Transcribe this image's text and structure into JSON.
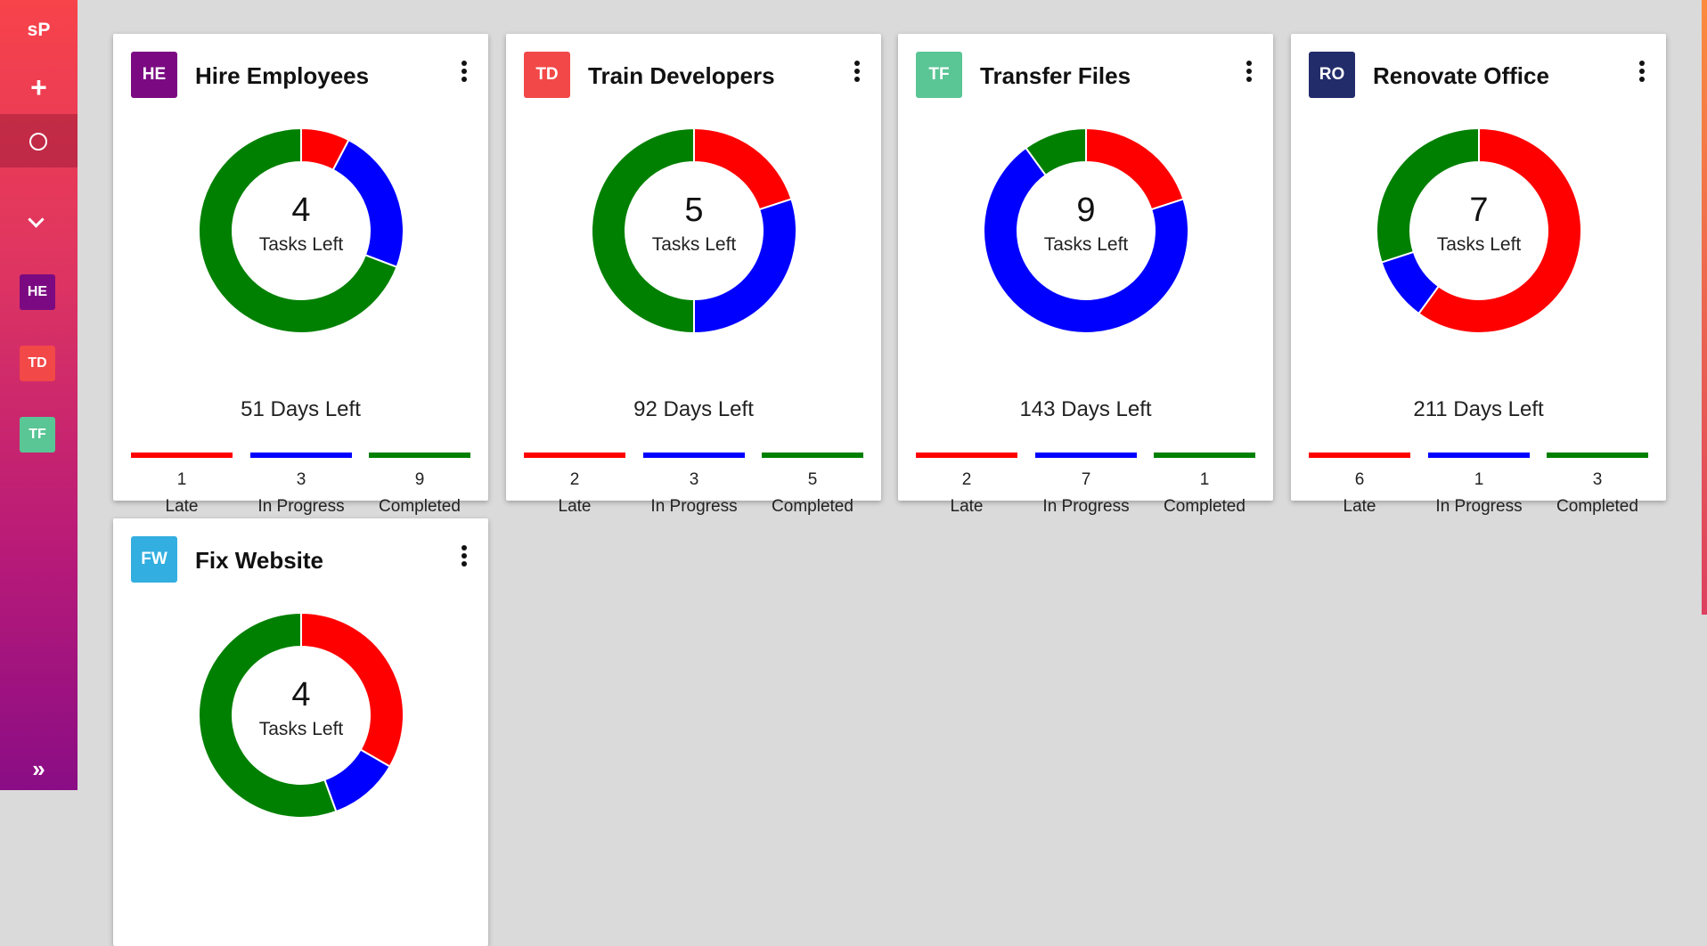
{
  "sidebar": {
    "logo": "sP",
    "add_glyph": "+",
    "active_icon": "circle-icon",
    "chevron_icon": "chevron-down-icon",
    "projects": [
      {
        "initials": "HE",
        "color": "#7b0a82"
      },
      {
        "initials": "TD",
        "color": "#f24848"
      },
      {
        "initials": "TF",
        "color": "#5ac595"
      }
    ],
    "expand_glyph": "»"
  },
  "status_colors": {
    "late": "#ff0000",
    "in_progress": "#0000ff",
    "completed": "#008000"
  },
  "cards": [
    {
      "initials": "HE",
      "avatar_color": "#7b0a82",
      "title": "Hire Employees",
      "tasks_left": "4",
      "tasks_left_label": "Tasks Left",
      "days_left": "51 Days Left",
      "late": "1",
      "in_progress": "3",
      "completed": "9",
      "late_label": "Late",
      "in_progress_label": "In Progress",
      "completed_label": "Completed"
    },
    {
      "initials": "TD",
      "avatar_color": "#f24848",
      "title": "Train Developers",
      "tasks_left": "5",
      "tasks_left_label": "Tasks Left",
      "days_left": "92 Days Left",
      "late": "2",
      "in_progress": "3",
      "completed": "5",
      "late_label": "Late",
      "in_progress_label": "In Progress",
      "completed_label": "Completed"
    },
    {
      "initials": "TF",
      "avatar_color": "#5ac595",
      "title": "Transfer Files",
      "tasks_left": "9",
      "tasks_left_label": "Tasks Left",
      "days_left": "143 Days Left",
      "late": "2",
      "in_progress": "7",
      "completed": "1",
      "late_label": "Late",
      "in_progress_label": "In Progress",
      "completed_label": "Completed"
    },
    {
      "initials": "RO",
      "avatar_color": "#232c6a",
      "title": "Renovate Office",
      "tasks_left": "7",
      "tasks_left_label": "Tasks Left",
      "days_left": "211 Days Left",
      "late": "6",
      "in_progress": "1",
      "completed": "3",
      "late_label": "Late",
      "in_progress_label": "In Progress",
      "completed_label": "Completed"
    },
    {
      "initials": "FW",
      "avatar_color": "#33aee0",
      "title": "Fix Website",
      "tasks_left": "4",
      "tasks_left_label": "Tasks Left",
      "late": "3",
      "in_progress": "1",
      "completed": "5"
    }
  ],
  "chart_data": [
    {
      "type": "pie",
      "categories": [
        "Late",
        "In Progress",
        "Completed"
      ],
      "values": [
        1,
        3,
        9
      ]
    },
    {
      "type": "pie",
      "categories": [
        "Late",
        "In Progress",
        "Completed"
      ],
      "values": [
        2,
        3,
        5
      ]
    },
    {
      "type": "pie",
      "categories": [
        "Late",
        "In Progress",
        "Completed"
      ],
      "values": [
        2,
        7,
        1
      ]
    },
    {
      "type": "pie",
      "categories": [
        "Late",
        "In Progress",
        "Completed"
      ],
      "values": [
        6,
        1,
        3
      ]
    },
    {
      "type": "pie",
      "categories": [
        "Late",
        "In Progress",
        "Completed"
      ],
      "values": [
        3,
        1,
        5
      ]
    }
  ]
}
